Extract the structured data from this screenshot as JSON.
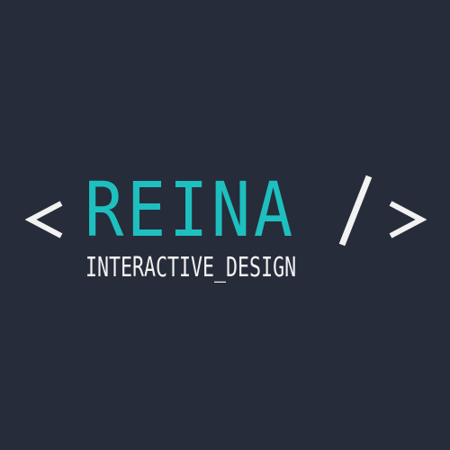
{
  "logo": {
    "open_bracket_icon": "less-than-bracket",
    "wordmark": "REINA",
    "slash_icon": "forward-slash",
    "close_bracket_icon": "greater-than-bracket",
    "tagline": "INTERACTIVE_DESIGN"
  },
  "colors": {
    "background": "#272c3a",
    "accent": "#1ebfbf",
    "text": "#f2f2f2"
  }
}
